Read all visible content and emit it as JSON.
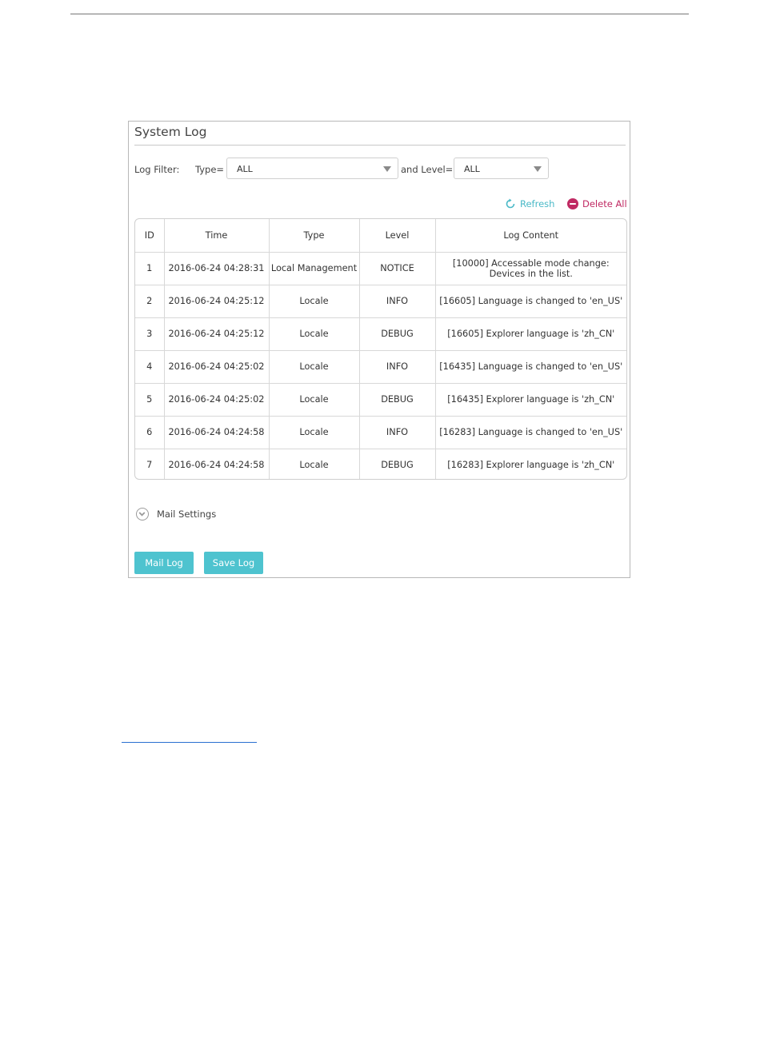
{
  "panel": {
    "title": "System Log",
    "filter": {
      "label": "Log Filter:",
      "type_label": "Type=",
      "type_value": "ALL",
      "level_label": "and Level=",
      "level_value": "ALL"
    },
    "actions": {
      "refresh_label": "Refresh",
      "delete_all_label": "Delete All"
    },
    "colors": {
      "accent": "#4ab9c7",
      "danger": "#c02a63",
      "button": "#4ec3cf"
    },
    "table": {
      "headers": [
        "ID",
        "Time",
        "Type",
        "Level",
        "Log Content"
      ],
      "rows": [
        [
          "1",
          "2016-06-24 04:28:31",
          "Local Management",
          "NOTICE",
          "[10000] Accessable mode change: Devices in the list."
        ],
        [
          "2",
          "2016-06-24 04:25:12",
          "Locale",
          "INFO",
          "[16605] Language is changed to 'en_US'"
        ],
        [
          "3",
          "2016-06-24 04:25:12",
          "Locale",
          "DEBUG",
          "[16605] Explorer language is 'zh_CN'"
        ],
        [
          "4",
          "2016-06-24 04:25:02",
          "Locale",
          "INFO",
          "[16435] Language is changed to 'en_US'"
        ],
        [
          "5",
          "2016-06-24 04:25:02",
          "Locale",
          "DEBUG",
          "[16435] Explorer language is 'zh_CN'"
        ],
        [
          "6",
          "2016-06-24 04:24:58",
          "Locale",
          "INFO",
          "[16283] Language is changed to 'en_US'"
        ],
        [
          "7",
          "2016-06-24 04:24:58",
          "Locale",
          "DEBUG",
          "[16283] Explorer language is 'zh_CN'"
        ]
      ]
    },
    "mail_settings_label": "Mail Settings",
    "buttons": {
      "mail_log": "Mail Log",
      "save_log": "Save Log"
    }
  }
}
